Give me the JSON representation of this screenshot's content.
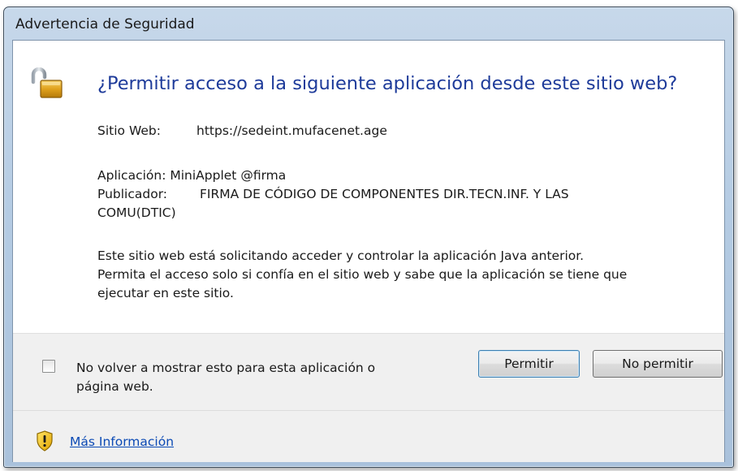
{
  "window": {
    "title": "Advertencia de Seguridad"
  },
  "dialog": {
    "heading": "¿Permitir acceso a la siguiente aplicación desde este sitio web?",
    "site_label": "Sitio Web:",
    "site_value": "https://sedeint.mufacenet.age",
    "app_label": "Aplicación:",
    "app_value": "MiniApplet @firma",
    "publisher_label": "Publicador:",
    "publisher_value_line1": "FIRMA DE CÓDIGO DE COMPONENTES DIR.TECN.INF. Y LAS",
    "publisher_value_line2": "COMU(DTIC)",
    "description_line1": "Este sitio web está solicitando acceder y controlar la aplicación Java anterior.",
    "description_line2": "Permita el acceso solo si confía en el sitio web y sabe que la aplicación se tiene que",
    "description_line3": "ejecutar en este sitio."
  },
  "footer": {
    "checkbox_label_line1": "No volver a mostrar esto para esta aplicación o",
    "checkbox_label_line2": "página web.",
    "checkbox_checked": false,
    "allow_button": "Permitir",
    "deny_button": "No permitir",
    "more_info_link": "Más Información"
  },
  "icons": {
    "header": "unlocked-padlock-icon",
    "footer": "warning-shield-icon"
  },
  "colors": {
    "heading": "#1e3b9a",
    "link": "#0b4ab5",
    "footer_bg": "#f0f0f0",
    "titlebar": "#b4cbe3"
  }
}
